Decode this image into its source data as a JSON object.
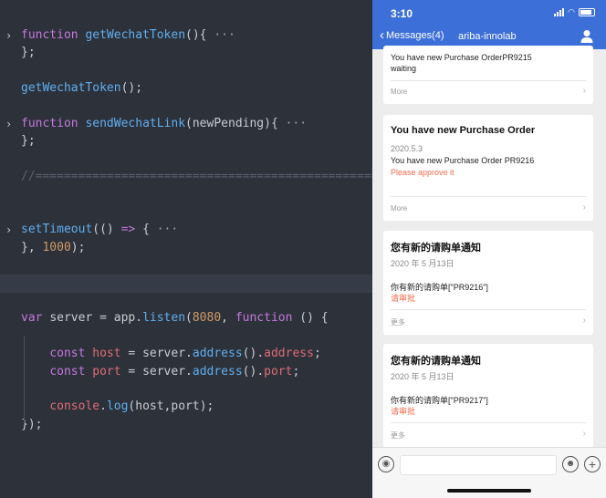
{
  "editor": {
    "lines": [
      {
        "fold": "›",
        "tokens": [
          [
            "kw",
            "function "
          ],
          [
            "fn",
            "getWechatToken"
          ],
          [
            "pl",
            "(){ "
          ],
          [
            "ell",
            "···"
          ]
        ]
      },
      {
        "fold": "",
        "tokens": [
          [
            "pl",
            "};"
          ]
        ]
      },
      {
        "fold": "",
        "tokens": []
      },
      {
        "fold": "",
        "tokens": [
          [
            "fn",
            "getWechatToken"
          ],
          [
            "pl",
            "();"
          ]
        ]
      },
      {
        "fold": "",
        "tokens": []
      },
      {
        "fold": "›",
        "tokens": [
          [
            "kw",
            "function "
          ],
          [
            "fn",
            "sendWechatLink"
          ],
          [
            "pl",
            "(newPending){ "
          ],
          [
            "ell",
            "···"
          ]
        ]
      },
      {
        "fold": "",
        "tokens": [
          [
            "pl",
            "};"
          ]
        ]
      },
      {
        "fold": "",
        "tokens": []
      },
      {
        "fold": "",
        "tokens": [
          [
            "cm",
            "//==================================================="
          ]
        ]
      },
      {
        "fold": "",
        "tokens": []
      },
      {
        "fold": "",
        "tokens": []
      },
      {
        "fold": "›",
        "tokens": [
          [
            "fn",
            "setTimeout"
          ],
          [
            "pl",
            "(() "
          ],
          [
            "kw",
            "=>"
          ],
          [
            "pl",
            " { "
          ],
          [
            "ell",
            "···"
          ]
        ]
      },
      {
        "fold": "",
        "tokens": [
          [
            "pl",
            "}, "
          ],
          [
            "num",
            "1000"
          ],
          [
            "pl",
            ");"
          ]
        ]
      },
      {
        "fold": "",
        "tokens": []
      },
      {
        "fold": "",
        "highlight": true,
        "tokens": []
      },
      {
        "fold": "",
        "tokens": []
      },
      {
        "fold": "",
        "tokens": [
          [
            "kw",
            "var "
          ],
          [
            "pl",
            "server = app."
          ],
          [
            "fn",
            "listen"
          ],
          [
            "pl",
            "("
          ],
          [
            "num",
            "8080"
          ],
          [
            "pl",
            ", "
          ],
          [
            "kw",
            "function"
          ],
          [
            "pl",
            " () {"
          ]
        ]
      },
      {
        "fold": "",
        "tokens": []
      },
      {
        "fold": "",
        "tokens": [
          [
            "pl",
            "    "
          ],
          [
            "kw",
            "const "
          ],
          [
            "prop",
            "host"
          ],
          [
            "pl",
            " = server."
          ],
          [
            "fn",
            "address"
          ],
          [
            "pl",
            "()."
          ],
          [
            "prop",
            "address"
          ],
          [
            "pl",
            ";"
          ]
        ]
      },
      {
        "fold": "",
        "tokens": [
          [
            "pl",
            "    "
          ],
          [
            "kw",
            "const "
          ],
          [
            "prop",
            "port"
          ],
          [
            "pl",
            " = server."
          ],
          [
            "fn",
            "address"
          ],
          [
            "pl",
            "()."
          ],
          [
            "prop",
            "port"
          ],
          [
            "pl",
            ";"
          ]
        ]
      },
      {
        "fold": "",
        "tokens": []
      },
      {
        "fold": "",
        "tokens": [
          [
            "pl",
            "    "
          ],
          [
            "prop",
            "console"
          ],
          [
            "pl",
            "."
          ],
          [
            "fn",
            "log"
          ],
          [
            "pl",
            "(host,port);"
          ]
        ]
      },
      {
        "fold": "",
        "tokens": [
          [
            "pl",
            "});"
          ]
        ]
      }
    ]
  },
  "phone": {
    "status_time": "3:10",
    "back_label": "Messages(4)",
    "back_chevron": "‹",
    "title": "ariba-innolab",
    "cards": [
      {
        "title": "",
        "date": "",
        "lines": [
          "You have new Purchase OrderPR9215",
          "waiting"
        ],
        "warn": "",
        "more": "More"
      },
      {
        "title": "You have new Purchase Order",
        "date": "2020.5.3",
        "lines": [
          "You have new Purchase Order PR9216"
        ],
        "warn": "Please approve it",
        "more": "More"
      },
      {
        "title": "您有新的请购单通知",
        "date": "2020 年 5 月13日",
        "lines": [
          "你有新的请购单[\"PR9216\"]"
        ],
        "warn": "请审批",
        "more": "更多"
      },
      {
        "title": "您有新的请购单通知",
        "date": "2020 年 5 月13日",
        "lines": [
          "你有新的请购单[\"PR9217\"]"
        ],
        "warn": "请审批",
        "more": "更多"
      }
    ],
    "input_placeholder": ""
  },
  "colors": {
    "editor_bg": "#2c313a",
    "keyword": "#c678dd",
    "function": "#61afef",
    "number": "#d19a66",
    "property": "#e06c75",
    "comment": "#5c6370",
    "nav_blue": "#3c6fd7",
    "warn": "#f26c4f"
  },
  "icons": {
    "fold": "chevron-right-icon",
    "back": "chevron-left-icon",
    "user": "user-icon",
    "voice": "voice-icon",
    "emoji": "emoji-icon",
    "plus": "plus-icon",
    "arrow": "chevron-right-icon"
  }
}
